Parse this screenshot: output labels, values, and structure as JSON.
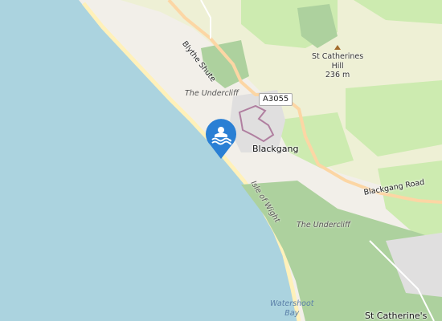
{
  "map": {
    "colors": {
      "sea": "#abd3df",
      "land": "#f2efe9",
      "farmland": "#eef0d5",
      "grass": "#cdebb0",
      "wood": "#add19e",
      "primary_road": "#fcd6a4",
      "road_casing": "#c8a06a",
      "beach": "#fff1ba",
      "residential": "#e0dfdf",
      "boundary": "#b07fa0",
      "marker": "#2a7fd4"
    },
    "labels": {
      "blythe_shute": "Blythe Shute",
      "a3055": "A3055",
      "undercliff_north": "The Undercliff",
      "blackgang": "Blackgang",
      "isle_of_wight": "Isle of Wight",
      "undercliff_south": "The Undercliff",
      "blackgang_road": "Blackgang Road",
      "st_catherines_hill": "St Catherines",
      "hill_word": "Hill",
      "hill_elevation": "236 m",
      "watershoot": "Watershoot",
      "bay": "Bay",
      "st_catherines": "St Catherine's"
    },
    "marker_icon": "swimming-icon"
  }
}
